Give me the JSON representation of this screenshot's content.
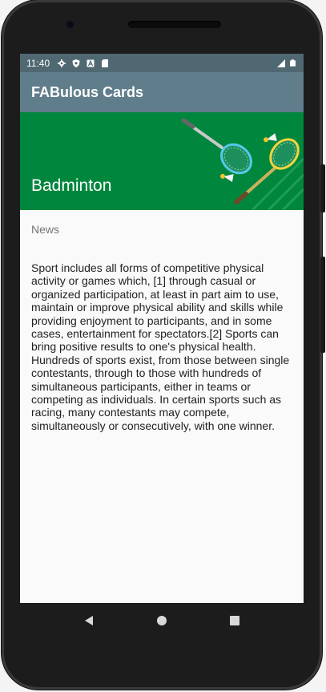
{
  "status_bar": {
    "time": "11:40",
    "left_icons": [
      "gear-icon",
      "shield-icon",
      "a-icon",
      "sd-card-icon"
    ],
    "right_icons": [
      "signal-icon",
      "battery-icon"
    ]
  },
  "app_bar": {
    "title": "FABulous Cards"
  },
  "hero": {
    "title": "Badminton",
    "background_color": "#00873d",
    "art": "badminton-rackets-illustration"
  },
  "content": {
    "section_label": "News",
    "body": "Sport includes all forms of competitive physical activity or games which, [1] through casual or organized participation, at least in part aim to use, maintain or improve physical ability and skills while providing enjoyment to participants, and in some cases, entertainment for spectators.[2] Sports can bring positive results to one's physical health. Hundreds of sports exist, from those between single contestants, through to those with hundreds of simultaneous participants, either in teams or competing as individuals. In certain sports such as racing, many contestants may compete, simultaneously or consecutively, with one winner."
  },
  "nav_bar": {
    "buttons": [
      "back-icon",
      "home-icon",
      "recents-icon"
    ]
  },
  "colors": {
    "app_bar": "#607d8b",
    "status_bar": "#4f6871",
    "hero": "#00873d",
    "screen_bg": "#fafafa"
  }
}
